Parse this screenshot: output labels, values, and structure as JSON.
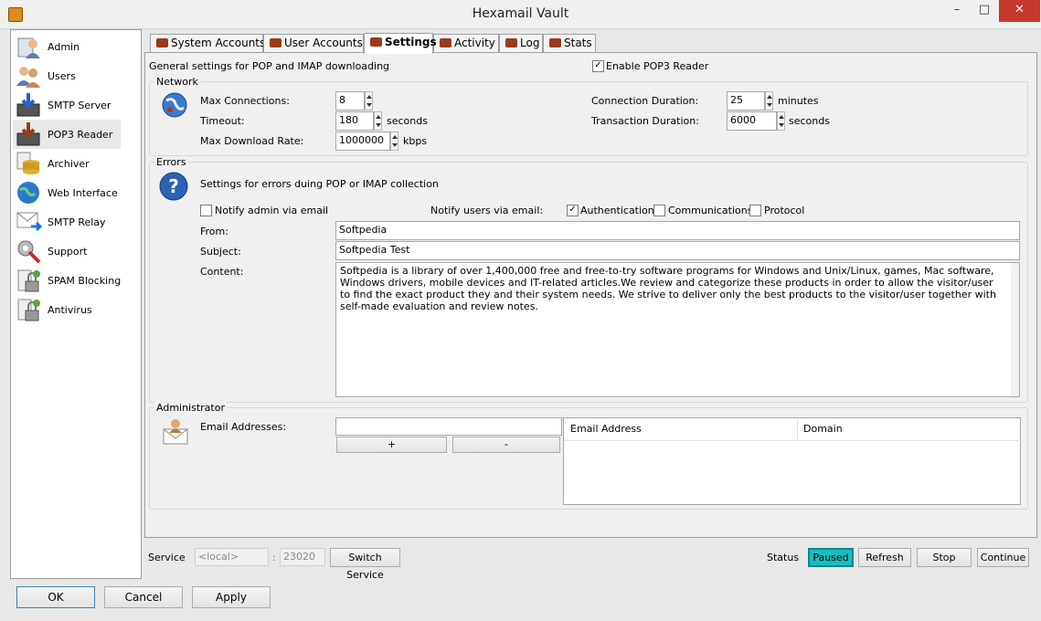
{
  "window": {
    "title": "Hexamail Vault",
    "minimize": "–",
    "maximize": "□",
    "close": "✕"
  },
  "nav": [
    {
      "label": "Admin",
      "icon": "admin-icon",
      "color": "#7a8aa0"
    },
    {
      "label": "Users",
      "icon": "users-icon",
      "color": "#c08a50"
    },
    {
      "label": "SMTP Server",
      "icon": "smtp-server-icon",
      "color": "#2a62c8"
    },
    {
      "label": "POP3 Reader",
      "icon": "pop3-reader-icon",
      "color": "#9a3a1a"
    },
    {
      "label": "Archiver",
      "icon": "archiver-icon",
      "color": "#e0b030"
    },
    {
      "label": "Web Interface",
      "icon": "web-interface-icon",
      "color": "#2a7acc"
    },
    {
      "label": "SMTP Relay",
      "icon": "smtp-relay-icon",
      "color": "#1a7ad8"
    },
    {
      "label": "Support",
      "icon": "support-icon",
      "color": "#8a8a8a"
    },
    {
      "label": "SPAM Blocking",
      "icon": "spam-blocking-icon",
      "color": "#5aa83a"
    },
    {
      "label": "Antivirus",
      "icon": "antivirus-icon",
      "color": "#5aa83a"
    }
  ],
  "tabs": [
    "System Accounts",
    "User Accounts",
    "Settings",
    "Activity",
    "Log",
    "Stats"
  ],
  "settings": {
    "heading": "General settings for POP and IMAP downloading",
    "enable_label": "Enable POP3 Reader",
    "enable_checked": true,
    "network": {
      "title": "Network",
      "max_conn_label": "Max Connections:",
      "max_conn": "8",
      "timeout_label": "Timeout:",
      "timeout": "180",
      "timeout_unit": "seconds",
      "max_dl_label": "Max Download Rate:",
      "max_dl": "1000000",
      "max_dl_unit": "kbps",
      "conn_dur_label": "Connection Duration:",
      "conn_dur": "25",
      "conn_dur_unit": "minutes",
      "trans_dur_label": "Transaction Duration:",
      "trans_dur": "6000",
      "trans_dur_unit": "seconds"
    },
    "errors": {
      "title": "Errors",
      "desc": "Settings for errors duing POP or IMAP collection",
      "notify_admin": "Notify admin via email",
      "notify_users": "Notify users via email:",
      "auth": "Authentication",
      "auth_checked": true,
      "comm": "Communications",
      "proto": "Protocol",
      "from_label": "From:",
      "from": "Softpedia",
      "subject_label": "Subject:",
      "subject": "Softpedia Test",
      "content_label": "Content:",
      "content": "Softpedia is a library of over 1,400,000 free and free-to-try software programs for Windows and Unix/Linux, games, Mac software, Windows drivers, mobile devices and IT-related articles.We review and categorize these products in order to allow the visitor/user to find the exact product they and their system needs. We strive to deliver only the best products to the visitor/user together with self-made evaluation and review notes."
    },
    "admin": {
      "title": "Administrator",
      "email_label": "Email Addresses:",
      "add": "+",
      "remove": "-",
      "col_email": "Email Address",
      "col_domain": "Domain"
    }
  },
  "service": {
    "label": "Service",
    "host": "<local>",
    "sep": ":",
    "port": "23020",
    "switch": "Switch Service",
    "status_label": "Status",
    "status": "Paused",
    "status_color": "#1bbcbc",
    "refresh": "Refresh",
    "stop": "Stop",
    "continue": "Continue"
  },
  "footer": {
    "ok": "OK",
    "cancel": "Cancel",
    "apply": "Apply"
  }
}
